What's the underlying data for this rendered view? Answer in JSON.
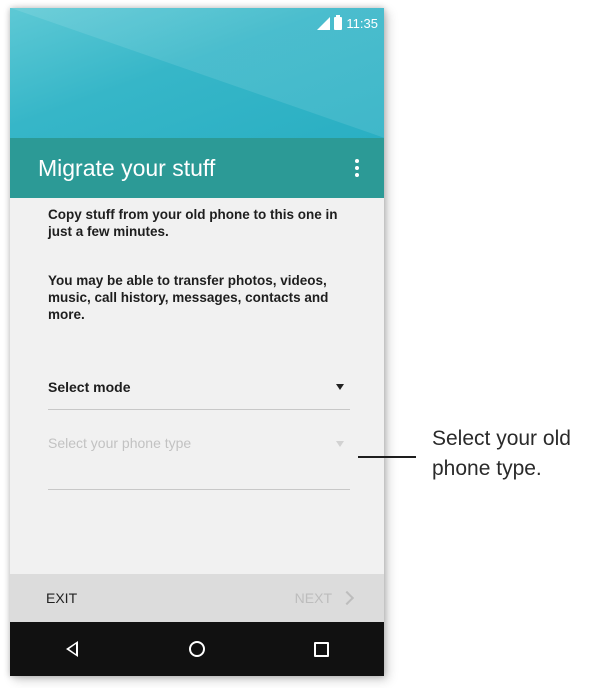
{
  "status_bar": {
    "time": "11:35"
  },
  "toolbar": {
    "title": "Migrate your stuff"
  },
  "content": {
    "paragraph1": "Copy stuff from your old phone to this one in just a few minutes.",
    "paragraph2": "You may be able to transfer photos, videos, music, call history, messages, contacts and more."
  },
  "mode_select": {
    "label": "Select mode"
  },
  "phone_type_select": {
    "placeholder": "Select your phone type"
  },
  "bottom_bar": {
    "exit_label": "EXIT",
    "next_label": "NEXT"
  },
  "callout": {
    "text": "Select your old phone type."
  },
  "colors": {
    "header": "#36b6c8",
    "toolbar": "#2c9a96",
    "content_bg": "#f1f1f1",
    "bottom_bar": "#dcdcdc",
    "nav_bar": "#111111"
  },
  "icons": [
    "signal-icon",
    "battery-icon",
    "overflow-menu-icon",
    "dropdown-arrow-icon",
    "chevron-right-icon",
    "back-icon",
    "home-icon",
    "recents-icon"
  ]
}
